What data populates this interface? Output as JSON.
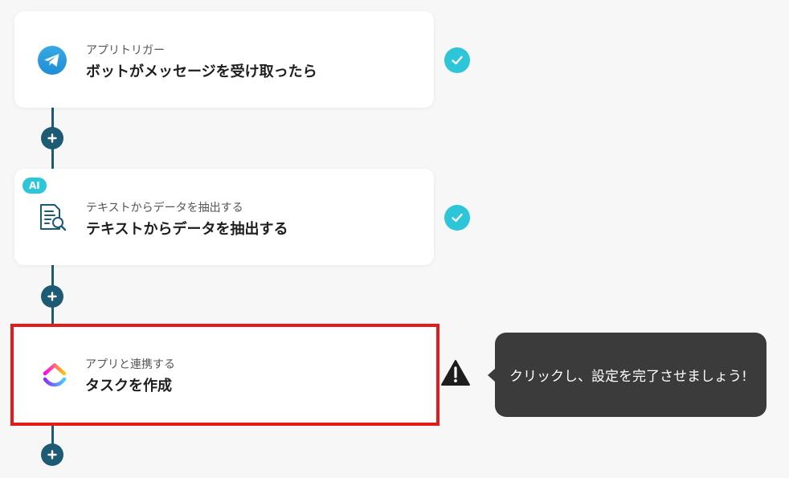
{
  "steps": [
    {
      "subtitle": "アプリトリガー",
      "title": "ボットがメッセージを受け取ったら",
      "icon": "telegram-icon",
      "status": "done"
    },
    {
      "badge": "AI",
      "subtitle": "テキストからデータを抽出する",
      "title": "テキストからデータを抽出する",
      "icon": "document-search-icon",
      "status": "done"
    },
    {
      "subtitle": "アプリと連携する",
      "title": "タスクを作成",
      "icon": "clickup-icon",
      "status": "warning"
    }
  ],
  "tooltip": {
    "text": "クリックし、設定を完了させましょう!"
  },
  "colors": {
    "connector": "#1c5b73",
    "check": "#2cc6d8",
    "highlight_border": "#e01c1c",
    "tooltip_bg": "#3b3b3b"
  }
}
